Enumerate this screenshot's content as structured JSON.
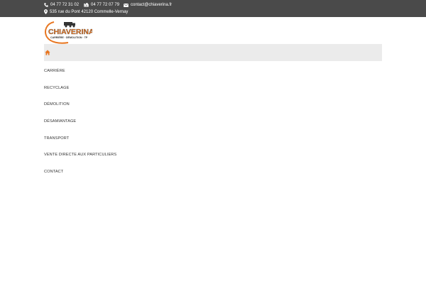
{
  "topbar": {
    "phone1": "04 77 72 31 02",
    "phone2": "04 77 72 07 79",
    "email": "contact@chiaverina.fr",
    "address": "535 rue du Pont 42120 Commelle-Vernay"
  },
  "logo": {
    "name": "CHIAVERINA",
    "tagline": "CARRIÈRE · DÉMOLITION · TP"
  },
  "colors": {
    "accent": "#e87722",
    "topbar": "#4a4a4a",
    "navbar": "#ebebeb"
  },
  "nav": {
    "home_icon": "home-icon"
  },
  "menu": {
    "items": [
      "CARRIÈRE",
      "RECYCLAGE",
      "DÉMOLITION",
      "DÉSAMIANTAGE",
      "TRANSPORT",
      "VENTE DIRECTE AUX PARTICULIERS",
      "CONTACT"
    ]
  }
}
